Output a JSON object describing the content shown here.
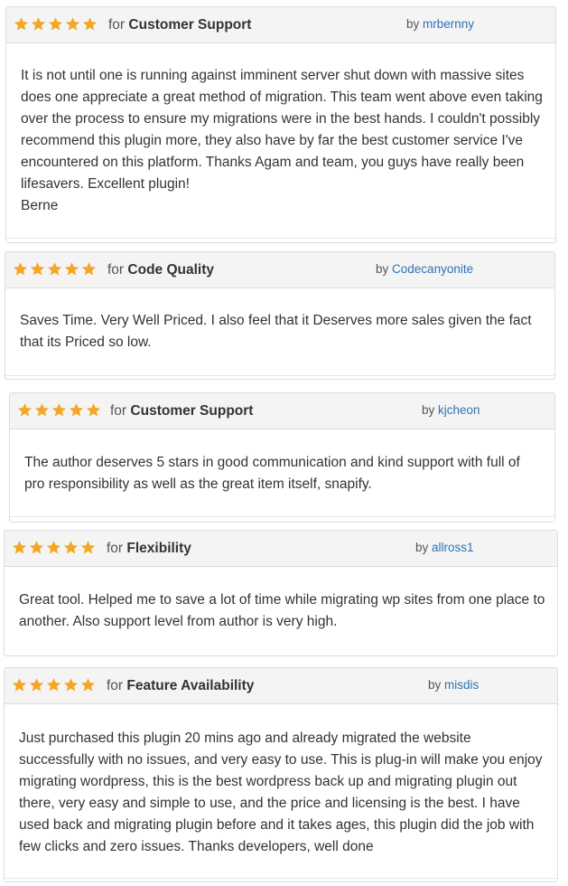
{
  "reviews": [
    {
      "prefix": "for",
      "category": "Customer Support",
      "by_label": "by",
      "author": "mrbernny",
      "rating": 5,
      "body": "It is not until one is running against imminent server shut down with massive sites does one appreciate a great method of migration. This team went above even taking over the process to ensure my migrations were in the best hands. I couldn't possibly recommend this plugin more, they also have by far the best customer service I've encountered on this platform. Thanks Agam and team, you guys have really been lifesavers. Excellent plugin!\nBerne"
    },
    {
      "prefix": "for",
      "category": "Code Quality",
      "by_label": "by",
      "author": "Codecanyonite",
      "rating": 5,
      "body": "Saves Time. Very Well Priced. I also feel that it Deserves more sales given the fact that its Priced so low."
    },
    {
      "prefix": "for",
      "category": "Customer Support",
      "by_label": "by",
      "author": "kjcheon",
      "rating": 5,
      "body": "The author deserves 5 stars in good communication and kind support with full of pro responsibility as well as the great item itself, snapify."
    },
    {
      "prefix": "for",
      "category": "Flexibility",
      "by_label": "by",
      "author": "allross1",
      "rating": 5,
      "body": "Great tool. Helped me to save a lot of time while migrating wp sites from one place to another. Also support level from author is very high."
    },
    {
      "prefix": "for",
      "category": "Feature Availability",
      "by_label": "by",
      "author": "misdis",
      "rating": 5,
      "body": "Just purchased this plugin 20 mins ago and already migrated the website successfully with no issues, and very easy to use. This is plug-in will make you enjoy migrating wordpress, this is the best wordpress back up and migrating plugin out there, very easy and simple to use, and the price and licensing is the best. I have used back and migrating plugin before and it takes ages, this plugin did the job with few clicks and zero issues. Thanks developers, well done"
    }
  ],
  "colors": {
    "star": "#f5a623",
    "author_link": "#2e74b5",
    "header_bg": "#f4f4f4"
  },
  "icons": {
    "rating": "star-icon"
  }
}
